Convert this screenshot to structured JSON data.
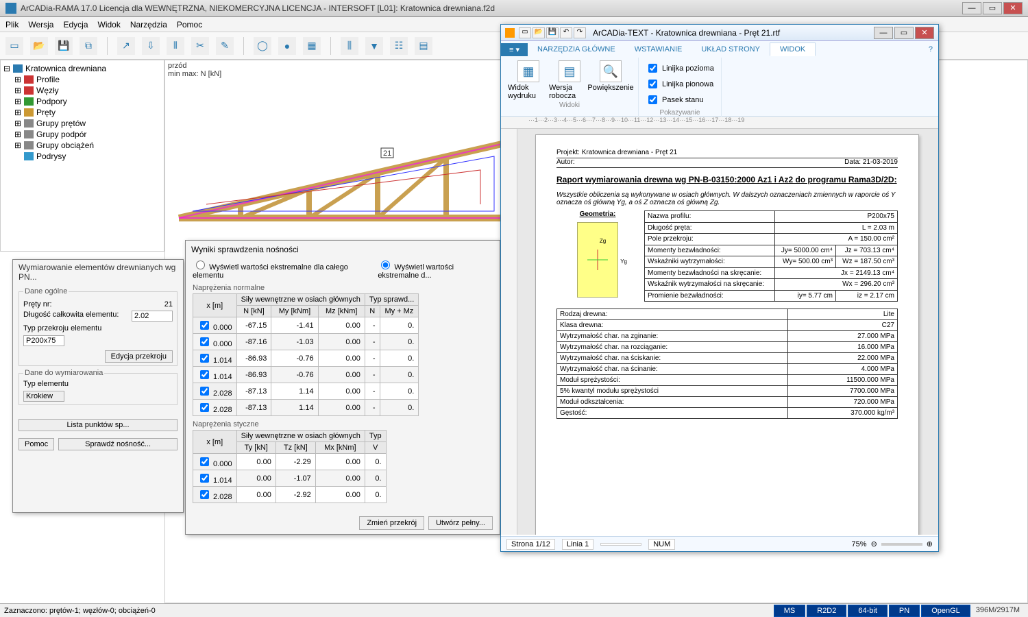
{
  "app": {
    "title": "ArCADia-RAMA 17.0 Licencja dla WEWNĘTRZNA, NIEKOMERCYJNA LICENCJA - INTERSOFT [L01]: Kratownica drewniana.f2d",
    "menu": [
      "Plik",
      "Wersja",
      "Edycja",
      "Widok",
      "Narzędzia",
      "Pomoc"
    ]
  },
  "tree": {
    "root": "Kratownica drewniana",
    "items": [
      "Profile",
      "Węzły",
      "Podpory",
      "Pręty",
      "Grupy prętów",
      "Grupy podpór",
      "Grupy obciążeń",
      "Podrysy"
    ]
  },
  "canvas": {
    "label1": "przód",
    "label2": "min max: N [kN]",
    "badge": "21"
  },
  "dlg1": {
    "title": "Wymiarowanie elementów drewnianych wg PN...",
    "g1": "Dane ogólne",
    "prety_lbl": "Pręty nr:",
    "prety_val": "21",
    "dlug_lbl": "Długość całkowita elementu:",
    "dlug_val": "2.02",
    "typ_lbl": "Typ przekroju elementu",
    "przekroj": "P200x75",
    "btn_edit": "Edycja przekroju",
    "g2": "Dane do wymiarowania",
    "typel_lbl": "Typ elementu",
    "typel_val": "Krokiew",
    "btn_lista": "Lista punktów sp...",
    "btn_pomoc": "Pomoc",
    "btn_sprawdz": "Sprawdź nośność..."
  },
  "dlg2": {
    "title": "Wyniki sprawdzenia nośności",
    "radio1": "Wyświetl wartości ekstremalne dla całego elementu",
    "radio2": "Wyświetl wartości ekstremalne d...",
    "sect1": "Naprężenia normalne",
    "hdr_sily": "Siły wewnętrzne w osiach głównych",
    "hdr_typ": "Typ sprawd...",
    "cols1": [
      "x [m]",
      "N [kN]",
      "My [kNm]",
      "Mz [kNm]",
      "N",
      "My + Mz"
    ],
    "rows1": [
      [
        "0.000",
        "-67.15",
        "-1.41",
        "0.00",
        "-",
        "0."
      ],
      [
        "0.000",
        "-87.16",
        "-1.03",
        "0.00",
        "-",
        "0."
      ],
      [
        "1.014",
        "-86.93",
        "-0.76",
        "0.00",
        "-",
        "0."
      ],
      [
        "1.014",
        "-86.93",
        "-0.76",
        "0.00",
        "-",
        "0."
      ],
      [
        "2.028",
        "-87.13",
        "1.14",
        "0.00",
        "-",
        "0."
      ],
      [
        "2.028",
        "-87.13",
        "1.14",
        "0.00",
        "-",
        "0."
      ]
    ],
    "sect2": "Naprężenia styczne",
    "cols2": [
      "x [m]",
      "Ty [kN]",
      "Tz [kN]",
      "Mx [kNm]",
      "V"
    ],
    "rows2": [
      [
        "0.000",
        "0.00",
        "-2.29",
        "0.00",
        "0."
      ],
      [
        "1.014",
        "0.00",
        "-1.07",
        "0.00",
        "0."
      ],
      [
        "2.028",
        "0.00",
        "-2.92",
        "0.00",
        "0."
      ]
    ],
    "btn_zmien": "Zmień przekrój",
    "btn_utworz": "Utwórz pełny..."
  },
  "textwin": {
    "title": "ArCADia-TEXT - Kratownica drewniana - Pręt 21.rtf",
    "tabs": [
      "NARZĘDZIA GŁÓWNE",
      "WSTAWIANIE",
      "UKŁAD STRONY",
      "WIDOK"
    ],
    "ribbon": {
      "view1": "Widok wydruku",
      "view2": "Wersja robocza",
      "view3": "Powiększenie",
      "grp1": "Widoki",
      "grp2": "Pokazywanie",
      "chk1": "Linijka pozioma",
      "chk2": "Linijka pionowa",
      "chk3": "Pasek stanu"
    },
    "doc": {
      "projekt_lbl": "Projekt:",
      "projekt": "Kratownica drewniana - Pręt 21",
      "autor_lbl": "Autor:",
      "data_lbl": "Data:",
      "data": "21-03-2019",
      "title": "Raport wymiarowania drewna wg PN-B-03150:2000 Az1 i Az2 do programu Rama3D/2D:",
      "note": "Wszystkie obliczenia są wykonywane w osiach głównych. W dalszych oznaczeniach zmiennych w raporcie oś Y oznacza oś główną Yg, a oś Z oznacza oś główną Zg.",
      "geom_lbl": "Geometria:",
      "geom_rows": [
        [
          "Nazwa profilu:",
          "",
          "P200x75"
        ],
        [
          "Długość pręta:",
          "",
          "L = 2.03 m"
        ],
        [
          "Pole przekroju:",
          "",
          "A = 150.00 cm²"
        ],
        [
          "Momenty bezwładności:",
          "Jy= 5000.00 cm⁴",
          "Jz = 703.13 cm⁴"
        ],
        [
          "Wskaźniki wytrzymałości:",
          "Wy= 500.00 cm³",
          "Wz = 187.50 cm³"
        ],
        [
          "Momenty bezwładności na skręcanie:",
          "",
          "Jx = 2149.13 cm⁴"
        ],
        [
          "Wskaźnik wytrzymałości na skręcanie:",
          "",
          "Wx = 296.20 cm³"
        ],
        [
          "Promienie bezwładności:",
          "iy= 5.77 cm",
          "iz = 2.17 cm"
        ]
      ],
      "rows2": [
        [
          "Rodzaj drewna:",
          "Lite"
        ],
        [
          "Klasa drewna:",
          "C27"
        ],
        [
          "Wytrzymałość char. na zginanie:",
          "27.000 MPa"
        ],
        [
          "Wytrzymałość char. na rozciąganie:",
          "16.000 MPa"
        ],
        [
          "Wytrzymałość char. na ściskanie:",
          "22.000 MPa"
        ],
        [
          "Wytrzymałość char. na ścinanie:",
          "4.000 MPa"
        ],
        [
          "Moduł sprężystości:",
          "11500.000 MPa"
        ],
        [
          "5% kwantyl modułu sprężystości",
          "7700.000 MPa"
        ],
        [
          "Moduł odkształcenia:",
          "720.000 MPa"
        ],
        [
          "Gęstość:",
          "370.000 kg/m³"
        ]
      ]
    },
    "status": {
      "strona": "Strona 1/12",
      "linia": "Linia 1",
      "num": "NUM",
      "zoom": "75%"
    }
  },
  "status": {
    "left": "Zaznaczono: prętów-1; węzłów-0; obciążeń-0",
    "badges": [
      "MS",
      "R2D2",
      "64-bit",
      "PN",
      "OpenGL"
    ],
    "mem": "396M/2917M"
  }
}
